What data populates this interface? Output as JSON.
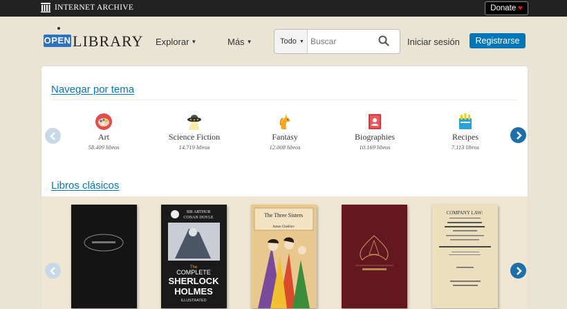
{
  "topbar": {
    "ia_label": "INTERNET ARCHIVE",
    "donate_label": "Donate",
    "donate_icon": "heart-icon"
  },
  "header": {
    "logo_open": "OPEN",
    "logo_library": "LIBRARY",
    "nav": [
      {
        "label": "Explorar"
      },
      {
        "label": "Más"
      }
    ],
    "search": {
      "scope": "Todo",
      "placeholder": "Buscar",
      "value": ""
    },
    "login_label": "Iniciar sesión",
    "register_label": "Registrarse"
  },
  "browse": {
    "title": "Navegar por tema",
    "subjects": [
      {
        "label": "Art",
        "count": "58.409 libros",
        "icon": "art-palette-icon"
      },
      {
        "label": "Science Fiction",
        "count": "14.719 libros",
        "icon": "ufo-icon"
      },
      {
        "label": "Fantasy",
        "count": "12.008 libros",
        "icon": "unicorn-icon"
      },
      {
        "label": "Biographies",
        "count": "10.169 libros",
        "icon": "biography-book-icon"
      },
      {
        "label": "Recipes",
        "count": "7.113 libros",
        "icon": "recipes-icon"
      }
    ]
  },
  "classics": {
    "title": "Libros clásicos",
    "books": [
      {
        "cover_text": "",
        "colors": [
          "#111111"
        ]
      },
      {
        "cover_text": [
          "SIR ARTHUR",
          "CONAN DOYLE",
          "The",
          "COMPLETE",
          "SHERLOCK",
          "HOLMES",
          "ILLUSTRATED"
        ],
        "colors": [
          "#1a1a1a"
        ]
      },
      {
        "cover_text": [
          "The Three Sisters",
          "Anton Chekhov"
        ],
        "colors": [
          "#e8c48a"
        ]
      },
      {
        "cover_text": "",
        "colors": [
          "#6b1a20"
        ]
      },
      {
        "cover_text": [
          "COMPANY LAW"
        ],
        "colors": [
          "#eadfbf"
        ]
      }
    ]
  },
  "colors": {
    "accent": "#0376b8",
    "background": "#e9e4d4",
    "arrow_active": "#1f6fa8",
    "arrow_inactive": "#c7d9e6"
  }
}
